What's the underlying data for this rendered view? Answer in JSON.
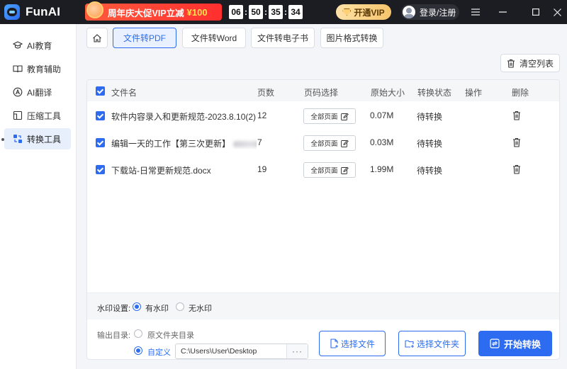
{
  "app": {
    "name": "FunAI",
    "promo_text": "周年庆大促VIP立减",
    "promo_price": "¥100",
    "countdown": [
      "06",
      "50",
      "35",
      "34"
    ],
    "vip_label": "开通VIP",
    "login_label": "登录/注册"
  },
  "sidebar": {
    "items": [
      {
        "label": "AI教育",
        "icon": "graduation-cap-icon"
      },
      {
        "label": "教育辅助",
        "icon": "book-icon"
      },
      {
        "label": "AI翻译",
        "icon": "translate-icon"
      },
      {
        "label": "压缩工具",
        "icon": "compress-icon"
      },
      {
        "label": "转换工具",
        "icon": "convert-icon",
        "active": true
      }
    ]
  },
  "tabs": [
    {
      "label": "文件转PDF",
      "active": true
    },
    {
      "label": "文件转Word"
    },
    {
      "label": "文件转电子书"
    },
    {
      "label": "图片格式转换"
    }
  ],
  "toolbar": {
    "clear_label": "清空列表"
  },
  "table": {
    "headers": {
      "name": "文件名",
      "pages": "页数",
      "page_select": "页码选择",
      "size": "原始大小",
      "status": "转换状态",
      "action": "操作",
      "delete": "删除"
    },
    "rows": [
      {
        "name": "软件内容录入和更新规范-2023.8.10(2).doc",
        "pages": "12",
        "page_select": "全部页面",
        "size": "0.07M",
        "status": "待转换"
      },
      {
        "name": "编辑一天的工作【第三次更新】",
        "name_suffix": "...",
        "pages": "7",
        "page_select": "全部页面",
        "size": "0.03M",
        "status": "待转换",
        "redacted": true
      },
      {
        "name": "下载站-日常更新规范.docx",
        "pages": "19",
        "page_select": "全部页面",
        "size": "1.99M",
        "status": "待转换"
      }
    ]
  },
  "watermark": {
    "label": "水印设置:",
    "options": [
      {
        "label": "有水印",
        "selected": true
      },
      {
        "label": "无水印",
        "selected": false
      }
    ]
  },
  "output": {
    "label": "输出目录:",
    "options": [
      {
        "label": "原文件夹目录",
        "selected": false
      },
      {
        "label": "自定义",
        "selected": true
      }
    ],
    "path": "C:\\Users\\User\\Desktop",
    "browse_label": "···",
    "select_file_label": "选择文件",
    "select_folder_label": "选择文件夹",
    "start_label": "开始转换"
  },
  "colors": {
    "accent": "#2d6cf0",
    "titlebar": "#1c1d22",
    "promo": "#ff3b30",
    "vip": "#f6c46b"
  }
}
